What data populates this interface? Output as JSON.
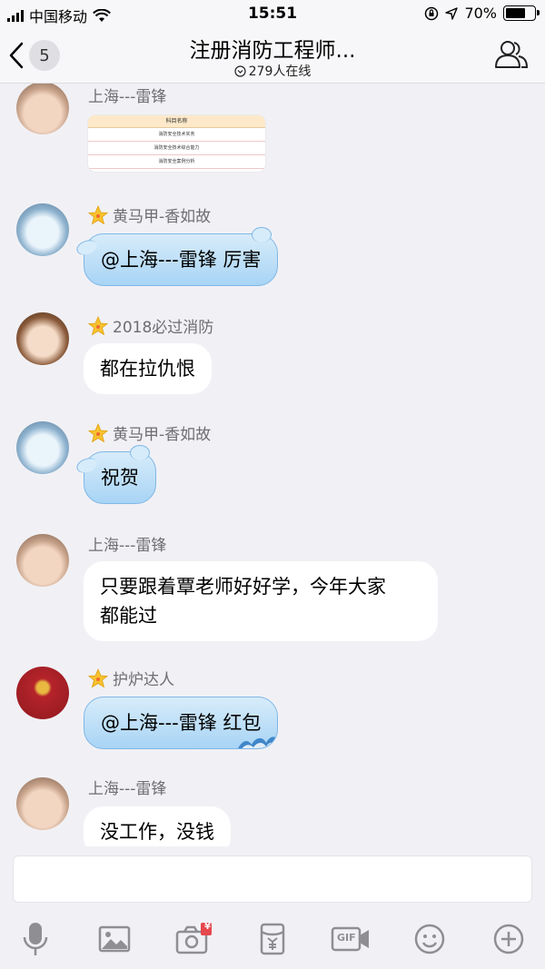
{
  "status": {
    "carrier": "中国移动",
    "time": "15:51",
    "battery": "70%",
    "battery_level": 0.7
  },
  "nav": {
    "back_count": "5",
    "title": "注册消防工程师...",
    "online": "279人在线"
  },
  "messages": [
    {
      "sender": "上海---雷锋",
      "type": "image",
      "image_table": {
        "header": "科目名称",
        "rows": [
          "消防安全技术实务",
          "消防安全技术综合能力",
          "消防安全案例分析"
        ]
      }
    },
    {
      "sender": "黄马甲-香如故",
      "star": true,
      "text": "@上海---雷锋 厉害",
      "style": "blue"
    },
    {
      "sender": "2018必过消防",
      "star": true,
      "text": "都在拉仇恨",
      "style": "white"
    },
    {
      "sender": "黄马甲-香如故",
      "star": true,
      "text": "祝贺",
      "style": "blue"
    },
    {
      "sender": "上海---雷锋",
      "text_line1": "只要跟着覃老师好好学，今年大家",
      "text_line2": "都能过",
      "style": "white"
    },
    {
      "sender": "护炉达人",
      "star": true,
      "text": "@上海---雷锋 红包",
      "style": "blue-wave"
    },
    {
      "sender": "上海---雷锋",
      "text": "没工作，没钱",
      "style": "white"
    }
  ],
  "toolbar": {
    "gif_label": "GIF",
    "red_badge": "¥",
    "items": [
      "voice-icon",
      "image-icon",
      "camera-icon",
      "red-packet-icon",
      "gif-icon",
      "emoji-icon",
      "plus-icon"
    ]
  }
}
